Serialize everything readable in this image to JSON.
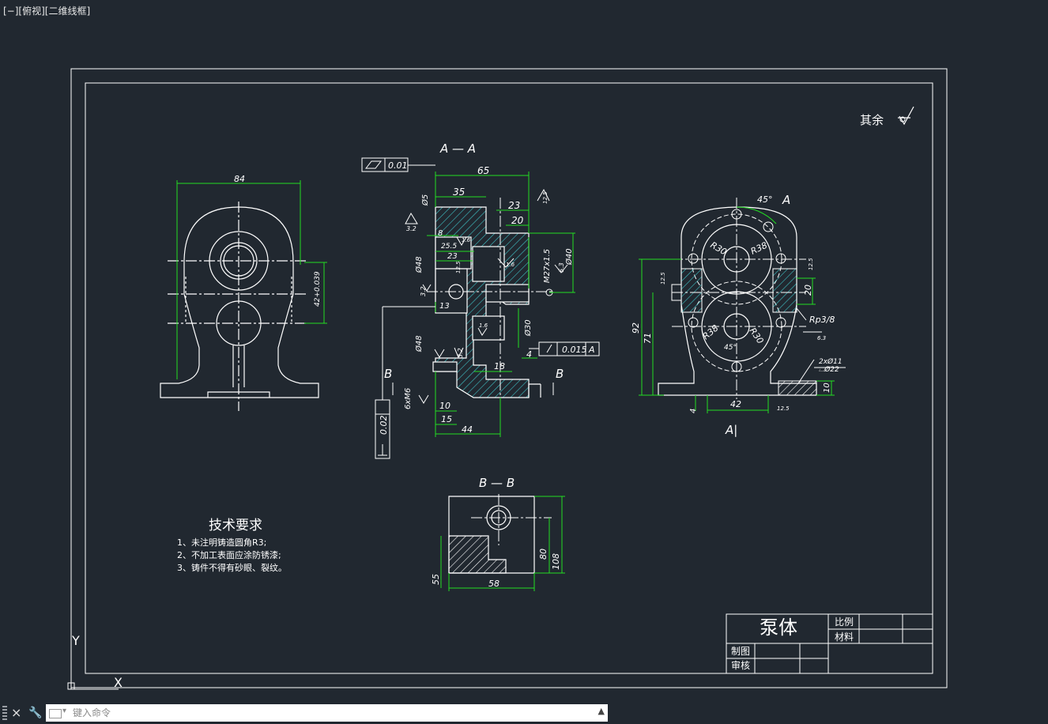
{
  "viewport": {
    "label": "[−][俯视][二维线框]"
  },
  "colors": {
    "background": "#212830",
    "geometry": "#ffffff",
    "dimension": "#22dd22",
    "hatch": "#3fc2c6"
  },
  "drawing": {
    "roughness_note": "其余",
    "sections": {
      "aa": "A — A",
      "bb": "B — B",
      "a_mark": "A",
      "b_mark": "B",
      "view_a": "A|"
    },
    "tech_requirements": {
      "title": "技术要求",
      "items": [
        "1、未注明铸造圆角R3;",
        "2、不加工表面应涂防锈漆;",
        "3、铸件不得有砂眼、裂纹。"
      ]
    },
    "title_block": {
      "part_name": "泵体",
      "scale_label": "比例",
      "material_label": "材料",
      "drawn_label": "制图",
      "checked_label": "审核"
    },
    "dims": {
      "d84": "84",
      "d42_039": "42+0.039",
      "d65": "65",
      "d35": "35",
      "d23a": "23",
      "d20a": "20",
      "d8": "8",
      "d25": "25.5",
      "d23b": "23",
      "d13": "13",
      "d10": "10",
      "d15": "15",
      "d44": "44",
      "d18": "18",
      "d4a": "4",
      "d5": "Ø5",
      "d48a": "Ø48",
      "d48b": "Ø48",
      "d40": "Ø40",
      "m27": "M27x1.5",
      "d30": "Ø30",
      "m6": "6xM6",
      "ra32a": "3.2",
      "ra32b": "3.2",
      "ra16a": "1.6",
      "ra16b": "1.6",
      "ra16c": "1.6",
      "ra32c": "3.2",
      "ra125a": "12.5",
      "ra63a": "6.3",
      "ra125b": "12.5",
      "tol_flat": "0.01",
      "tol_perp": "0.015",
      "tol_datum": "A",
      "tol_vert": "0.02",
      "d45a": "45°",
      "r30a": "R30",
      "r38a": "R38",
      "r38b": "R38",
      "r30b": "R30",
      "d45b": "45°",
      "d92": "92",
      "d71": "71",
      "d20b": "20",
      "d42": "42",
      "d4b": "4",
      "d10b": "10",
      "rp38": "Rp3/8",
      "d2x11": "2xØ11",
      "d22": "⌴Ø22",
      "ra63b": "6.3",
      "ra125c": "12.5",
      "ra125d": "12.5",
      "ra125e": "12.5",
      "d58": "58",
      "d55": "55",
      "d80": "80",
      "d108": "108"
    },
    "ucs": {
      "x": "X",
      "y": "Y"
    }
  },
  "command_line": {
    "placeholder": "键入命令",
    "close_label": "×",
    "customize_label": "🔧"
  }
}
